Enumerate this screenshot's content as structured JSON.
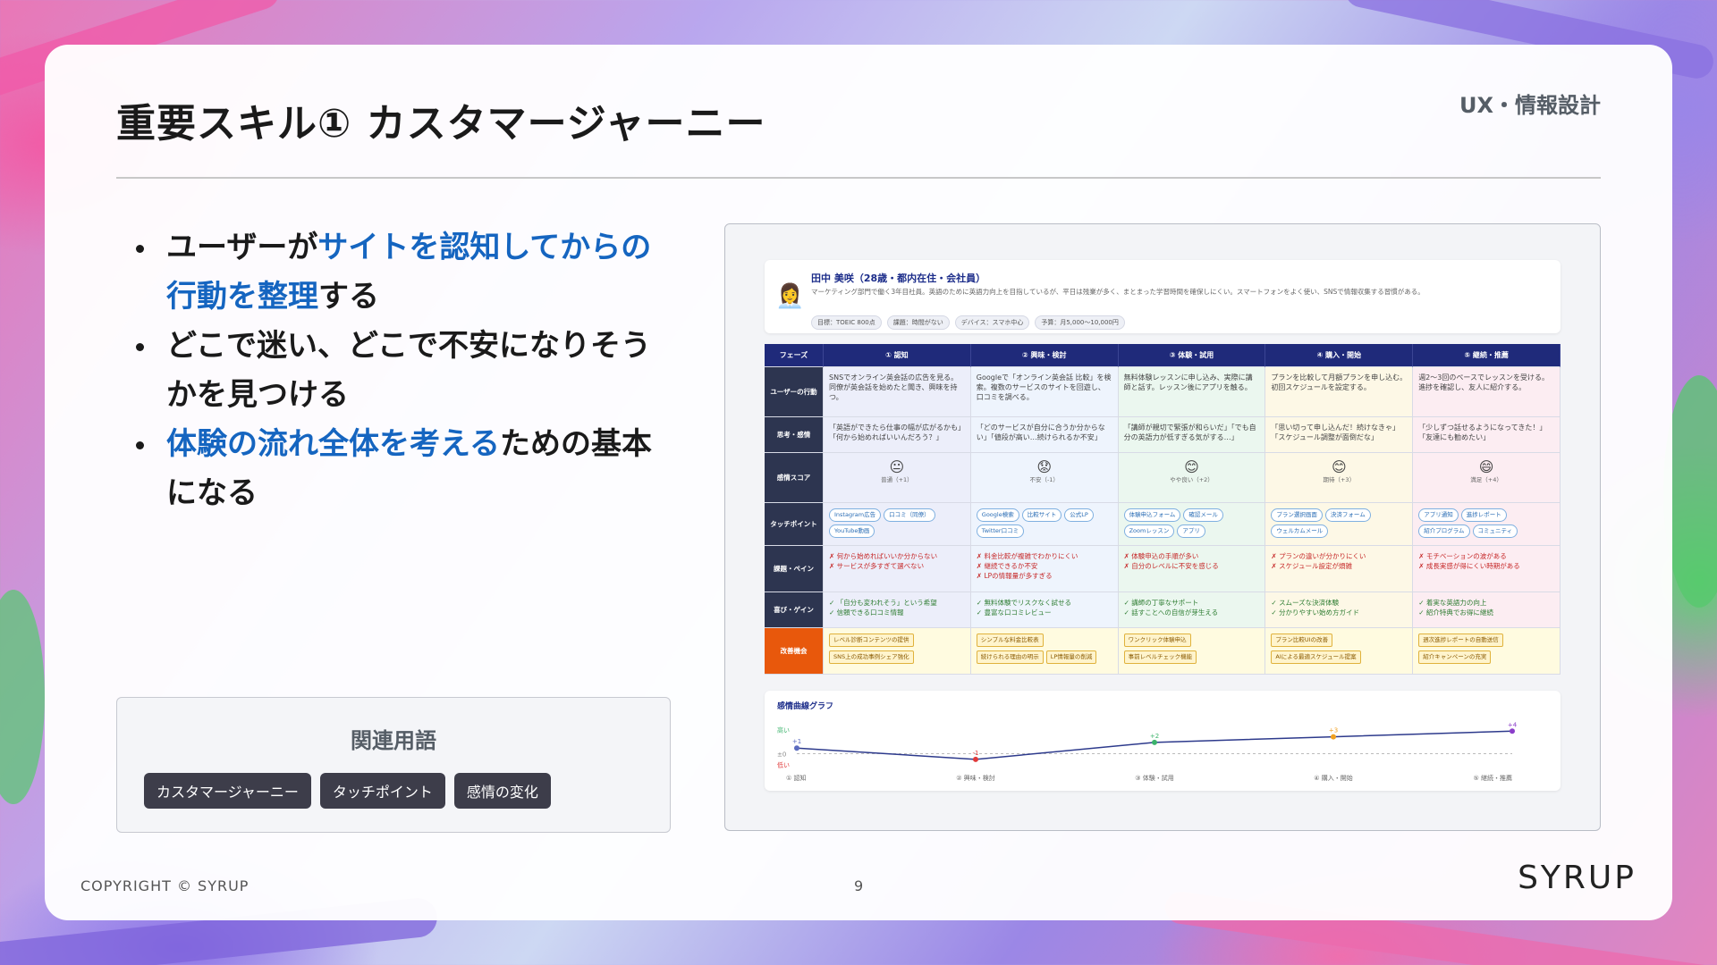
{
  "slide": {
    "title": "重要スキル① カスタマージャーニー",
    "category": "UX・情報設計",
    "bullets": [
      {
        "parts": [
          {
            "t": "ユーザーが",
            "hl": false
          },
          {
            "t": "サイトを認知してからの行動を整理",
            "hl": true
          },
          {
            "t": "する",
            "hl": false
          }
        ]
      },
      {
        "parts": [
          {
            "t": "どこで迷い、どこで不安になりそうかを見つける",
            "hl": false
          }
        ]
      },
      {
        "parts": [
          {
            "t": "体験の流れ全体を考える",
            "hl": true
          },
          {
            "t": "ための基本になる",
            "hl": false
          }
        ]
      }
    ],
    "related_title": "関連用語",
    "related_terms": [
      "カスタマージャーニー",
      "タッチポイント",
      "感情の変化"
    ],
    "copyright": "COPYRIGHT © SYRUP",
    "page_number": "9",
    "logo": "SYRUP"
  },
  "journey": {
    "persona": {
      "name": "田中 美咲（28歳・都内在住・会社員）",
      "description": "マーケティング部門で働く3年目社員。英語のために英語力向上を目指しているが、平日は残業が多く、まとまった学習時間を確保しにくい。スマートフォンをよく使い、SNSで情報収集する習慣がある。",
      "tags": [
        "目標：TOEIC 800点",
        "課題：時間がない",
        "デバイス：スマホ中心",
        "予算：月5,000〜10,000円"
      ]
    },
    "header_label": "フェーズ",
    "phases": [
      "① 認知",
      "② 興味・検討",
      "③ 体験・試用",
      "④ 購入・開始",
      "⑤ 継続・推薦"
    ],
    "row_labels": [
      "ユーザーの行動",
      "思考・感情",
      "感情スコア",
      "タッチポイント",
      "課題・ペイン",
      "喜び・ゲイン",
      "改善機会"
    ],
    "actions": [
      "SNSでオンライン英会話の広告を見る。同僚が英会話を始めたと聞き、興味を持つ。",
      "Googleで「オンライン英会話 比較」を検索。複数のサービスのサイトを回遊し、口コミを調べる。",
      "無料体験レッスンに申し込み、実際に講師と話す。レッスン後にアプリを触る。",
      "プランを比較して月額プランを申し込む。初回スケジュールを設定する。",
      "週2〜3回のペースでレッスンを受ける。進捗を確認し、友人に紹介する。"
    ],
    "thoughts": [
      "「英語ができたら仕事の幅が広がるかも」「何から始めればいいんだろう？」",
      "「どのサービスが自分に合うか分からない」「値段が高い…続けられるか不安」",
      "「講師が親切で緊張が和らいだ」「でも自分の英語力が低すぎる気がする…」",
      "「思い切って申し込んだ！続けなきゃ」「スケジュール調整が面倒だな」",
      "「少しずつ話せるようになってきた！」「友達にも勧めたい」"
    ],
    "emotions": [
      {
        "face": "😐",
        "label": "普通（+1）"
      },
      {
        "face": "😟",
        "label": "不安（-1）"
      },
      {
        "face": "😊",
        "label": "やや良い（+2）"
      },
      {
        "face": "😊",
        "label": "期待（+3）"
      },
      {
        "face": "😄",
        "label": "満足（+4）"
      }
    ],
    "touchpoints": [
      [
        "Instagram広告",
        "口コミ（同僚）",
        "YouTube動画"
      ],
      [
        "Google検索",
        "比較サイト",
        "公式LP",
        "Twitter口コミ"
      ],
      [
        "体験申込フォーム",
        "確認メール",
        "Zoomレッスン",
        "アプリ"
      ],
      [
        "プラン選択画面",
        "決済フォーム",
        "ウェルカムメール"
      ],
      [
        "アプリ通知",
        "進捗レポート",
        "紹介プログラム",
        "コミュニティ"
      ]
    ],
    "pains": [
      [
        "何から始めればいいか分からない",
        "サービスが多すぎて選べない"
      ],
      [
        "料金比較が複雑でわかりにくい",
        "継続できるか不安",
        "LPの情報量が多すぎる"
      ],
      [
        "体験申込の手順が多い",
        "自分のレベルに不安を感じる"
      ],
      [
        "プランの違いが分かりにくい",
        "スケジュール設定が煩雑"
      ],
      [
        "モチベーションの波がある",
        "成長実感が得にくい時期がある"
      ]
    ],
    "gains": [
      [
        "「自分も変われそう」という希望",
        "信頼できる口コミ情報"
      ],
      [
        "無料体験でリスクなく試せる",
        "豊富な口コミレビュー"
      ],
      [
        "講師の丁寧なサポート",
        "話すことへの自信が芽生える"
      ],
      [
        "スムーズな決済体験",
        "分かりやすい始め方ガイド"
      ],
      [
        "着実な英語力の向上",
        "紹介特典でお得に継続"
      ]
    ],
    "improvements": [
      [
        "レベル診断コンテンツの提供",
        "SNS上の成功事例シェア強化"
      ],
      [
        "シンプルな料金比較表",
        "続けられる理由の明示",
        "LP情報量の削減"
      ],
      [
        "ワンクリック体験申込",
        "事前レベルチェック機能"
      ],
      [
        "プラン比較UIの改善",
        "AIによる最適スケジュール提案"
      ],
      [
        "週次進捗レポートの自動送信",
        "紹介キャンペーンの充実"
      ]
    ],
    "graph": {
      "title": "感情曲線グラフ",
      "y_labels": [
        "高い",
        "±0",
        "低い"
      ],
      "points": [
        1,
        -1,
        2,
        3,
        4
      ],
      "point_labels": [
        "+1",
        "-1",
        "+2",
        "+3",
        "+4"
      ],
      "point_colors": [
        "#5b6bbf",
        "#e03a3a",
        "#3bb36b",
        "#f0a020",
        "#8b3ec9"
      ],
      "line_color": "#2d3a8c",
      "x_labels": [
        "① 認知",
        "② 興味・検討",
        "③ 体験・試用",
        "④ 購入・開始",
        "⑤ 継続・推薦"
      ]
    }
  }
}
